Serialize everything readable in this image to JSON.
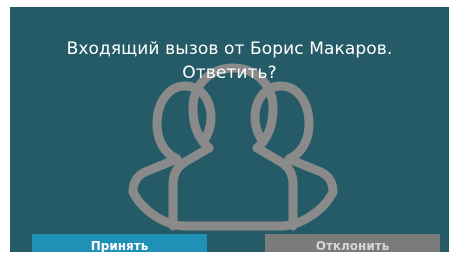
{
  "dialog": {
    "message_line1": "Входящий вызов от Борис Макаров.",
    "message_line2": "Ответить?",
    "accept_label": "Принять",
    "decline_label": "Отклонить",
    "illustration_icon": "people-group-icon"
  },
  "colors": {
    "background": "#245b66",
    "accept_button": "#1f91b7",
    "decline_button": "#7b7b7b",
    "illustration": "#8a8a8a"
  }
}
